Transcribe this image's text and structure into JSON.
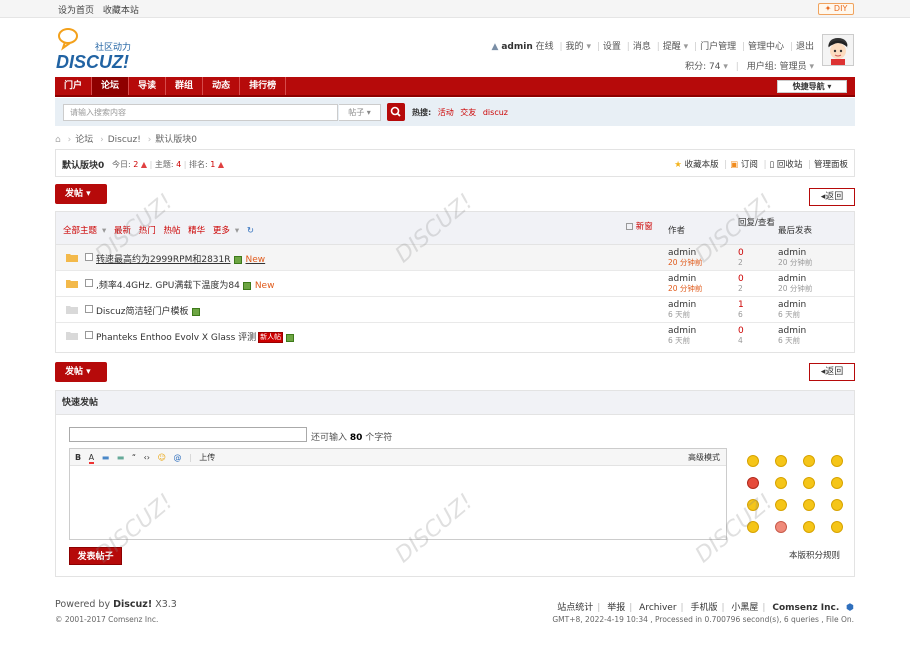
{
  "topbar": {
    "set_home": "设为首页",
    "bookmark_site": "收藏本站",
    "diy": "DIY"
  },
  "logo": {
    "wordmark": "DISCUZ!",
    "tagline": "社区动力"
  },
  "user": {
    "name": "admin",
    "status": "在线",
    "links": [
      "我的",
      "设置",
      "消息",
      "提醒",
      "门户管理",
      "管理中心",
      "退出"
    ],
    "credits_label": "积分: 74",
    "group_label": "用户组: 管理员"
  },
  "nav": {
    "items": [
      "门户",
      "论坛",
      "导读",
      "群组",
      "动态",
      "排行榜"
    ],
    "active_index": 1,
    "quick_nav": "快捷导航"
  },
  "search": {
    "placeholder": "请输入搜索内容",
    "scope": "帖子",
    "hot_label": "热搜:",
    "hot_words": [
      "活动",
      "交友",
      "discuz"
    ]
  },
  "breadcrumb": [
    "论坛",
    "Discuz!",
    "默认版块0"
  ],
  "forum": {
    "name": "默认版块0",
    "today_label": "今日:",
    "today_value": "2",
    "topics_label": "主题:",
    "topics_value": "4",
    "rank_label": "排名:",
    "rank_value": "1",
    "actions": [
      "收藏本版",
      "订阅",
      "回收站",
      "管理面板"
    ]
  },
  "buttons": {
    "post": "发帖",
    "back": "返回",
    "submit": "发表帖子"
  },
  "thread_list": {
    "filters": [
      "全部主题",
      "最新",
      "热门",
      "热帖",
      "精华",
      "更多"
    ],
    "new_window": "新窗",
    "col_author": "作者",
    "col_replies": "回复/查看",
    "col_last": "最后发表",
    "threads": [
      {
        "title": "转速最高约为2999RPM和2831R",
        "has_attach": true,
        "new": "New",
        "author": "admin",
        "time": "20 分钟前",
        "replies": "0",
        "views": "2",
        "last_user": "admin",
        "last_time": "20 分钟前",
        "underline": true
      },
      {
        "title": ",频率4.4GHz. GPU满载下温度为84",
        "has_attach": true,
        "new": "New",
        "author": "admin",
        "time": "20 分钟前",
        "replies": "0",
        "views": "2",
        "last_user": "admin",
        "last_time": "20 分钟前",
        "underline": false
      },
      {
        "title": "Discuz简洁轻门户模板",
        "has_attach": true,
        "new": "",
        "author": "admin",
        "time": "6 天前",
        "replies": "1",
        "views": "6",
        "last_user": "admin",
        "last_time": "6 天前",
        "underline": false
      },
      {
        "title": "Phanteks Enthoo Evolv X Glass 评测",
        "has_attach": true,
        "new": "",
        "tag": "新人帖",
        "author": "admin",
        "time": "6 天前",
        "replies": "0",
        "views": "4",
        "last_user": "admin",
        "last_time": "6 天前",
        "underline": false
      }
    ]
  },
  "quick_post": {
    "heading": "快速发帖",
    "remain_prefix": "还可输入",
    "remain_count": "80",
    "remain_suffix": "个字符",
    "toolbar": [
      "B",
      "A",
      "▬",
      "▬",
      "“",
      "‹›",
      "☺",
      "@"
    ],
    "upload": "上传",
    "advanced": "高级模式",
    "rules": "本版积分规则"
  },
  "footer": {
    "powered_prefix": "Powered by",
    "brand": "Discuz!",
    "version": "X3.3",
    "copyright": "© 2001-2017 Comsenz Inc.",
    "links": [
      "站点统计",
      "举报",
      "Archiver",
      "手机版",
      "小黑屋"
    ],
    "company": "Comsenz Inc.",
    "debug": "GMT+8, 2022-4-19 10:34 , Processed in 0.700796 second(s), 6 queries , File On."
  },
  "colors": {
    "brand_red": "#b60a0a",
    "link_red": "#cc0000",
    "logo_blue": "#2163a3",
    "new_orange": "#e05a1a"
  }
}
